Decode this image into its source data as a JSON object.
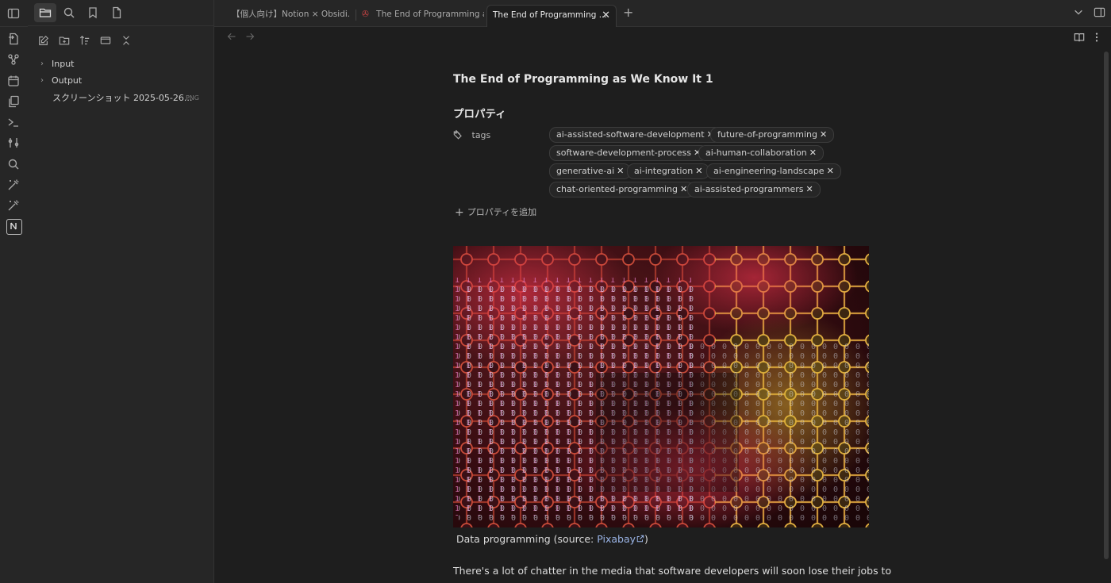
{
  "ribbon": {
    "icons": [
      "sidebar-toggle-icon",
      "open-quick-switcher-icon",
      "graph-view-icon",
      "daily-note-icon",
      "templates-icon",
      "terminal-icon",
      "command-palette-icon",
      "search-icon",
      "magic-wand-icon",
      "magic-wand-icon",
      "notion-logo-icon"
    ]
  },
  "sidebar": {
    "top_icons": [
      "file-explorer-icon",
      "search-icon",
      "bookmark-icon",
      "file-icon"
    ],
    "actions": [
      "new-note-icon",
      "new-folder-icon",
      "sort-icon",
      "collapse-icon",
      "close-icon"
    ],
    "tree": [
      {
        "type": "folder",
        "label": "Input"
      },
      {
        "type": "folder",
        "label": "Output"
      },
      {
        "type": "file",
        "label": "スクリーンショット 2025-05-26...",
        "badge": "PNG"
      }
    ]
  },
  "tabs": [
    {
      "label": "【個人向け】Notion × Obsidi..."
    },
    {
      "label": "The End of Programming a..."
    },
    {
      "label": "The End of Programming ...",
      "close": "✕"
    }
  ],
  "tabbar": {
    "new_tab": "+"
  },
  "note": {
    "title": "The End of Programming as We Know It 1",
    "properties_heading": "プロパティ",
    "tags_key": "tags",
    "tags": [
      "ai-assisted-software-development",
      "future-of-programming",
      "software-development-process",
      "ai-human-collaboration",
      "generative-ai",
      "ai-integration",
      "ai-engineering-landscape",
      "chat-oriented-programming",
      "ai-assisted-programmers"
    ],
    "tag_remove": "✕",
    "add_property": "プロパティを追加",
    "caption_prefix": "Data programming (source: ",
    "caption_link": "Pixabay",
    "caption_suffix": ")",
    "paragraph": "There's a lot of chatter in the media that software developers will soon lose their jobs to"
  }
}
